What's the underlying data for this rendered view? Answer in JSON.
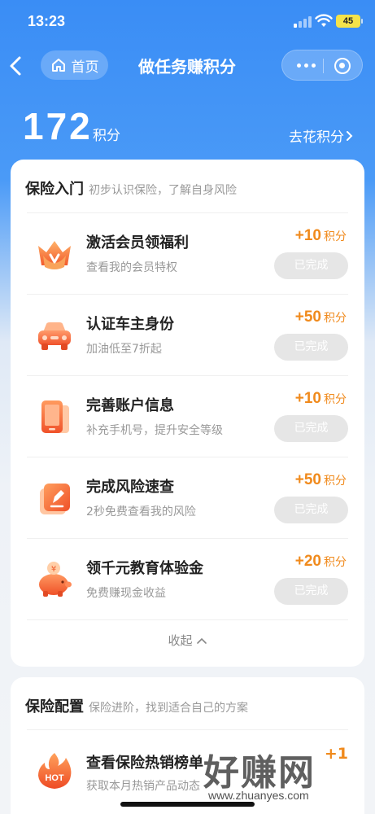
{
  "status_bar": {
    "time": "13:23",
    "battery": "45"
  },
  "nav": {
    "home_label": "首页",
    "title": "做任务赚积分"
  },
  "points": {
    "value": "172",
    "unit": "积分",
    "spend_link": "去花积分"
  },
  "section1": {
    "title": "保险入门",
    "subtitle": "初步认识保险，了解自身风险",
    "tasks": [
      {
        "title": "激活会员领福利",
        "desc": "查看我的会员特权",
        "reward": "+10",
        "reward_unit": "积分",
        "button": "已完成",
        "icon": "crown-icon"
      },
      {
        "title": "认证车主身份",
        "desc": "加油低至7折起",
        "reward": "+50",
        "reward_unit": "积分",
        "button": "已完成",
        "icon": "car-icon"
      },
      {
        "title": "完善账户信息",
        "desc": "补充手机号，提升安全等级",
        "reward": "+10",
        "reward_unit": "积分",
        "button": "已完成",
        "icon": "phone-icon"
      },
      {
        "title": "完成风险速查",
        "desc": "2秒免费查看我的风险",
        "reward": "+50",
        "reward_unit": "积分",
        "button": "已完成",
        "icon": "edit-note-icon"
      },
      {
        "title": "领千元教育体验金",
        "desc": "免费赚现金收益",
        "reward": "+20",
        "reward_unit": "积分",
        "button": "已完成",
        "icon": "piggy-bank-icon"
      }
    ],
    "collapse_label": "收起"
  },
  "section2": {
    "title": "保险配置",
    "subtitle": "保险进阶，找到适合自己的方案",
    "tasks": [
      {
        "title": "查看保险热销榜单",
        "desc": "获取本月热销产品动态",
        "reward": "+1",
        "icon": "hot-flame-icon",
        "icon_text": "HOT"
      }
    ]
  },
  "watermark": {
    "big": "好赚网",
    "small": "www.zhuanyes.com"
  },
  "colors": {
    "accent_orange": "#f08a1c",
    "header_blue": "#3a8df5",
    "done_button": "#e6e6e6"
  }
}
